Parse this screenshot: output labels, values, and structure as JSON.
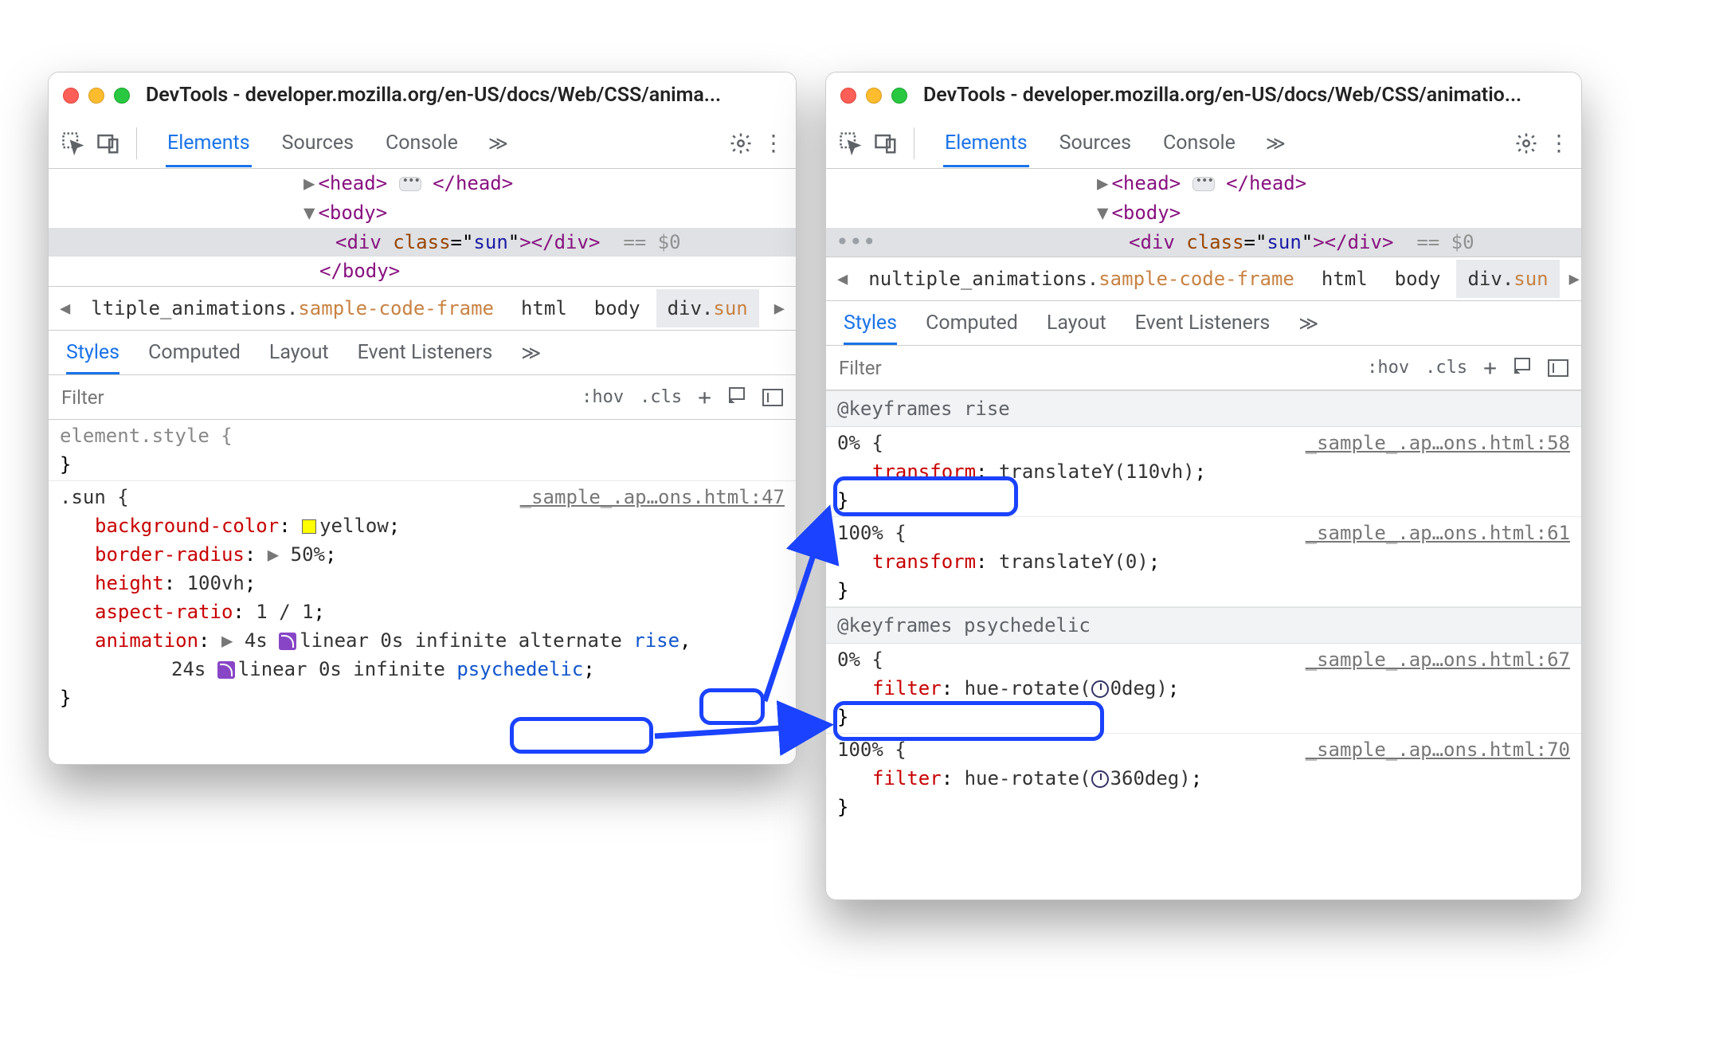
{
  "window_left": {
    "title": "DevTools - developer.mozilla.org/en-US/docs/Web/CSS/anima...",
    "tabs": [
      "Elements",
      "Sources",
      "Console"
    ],
    "dom": {
      "head_open": "<head>",
      "head_close": "</head>",
      "body_open": "<body>",
      "body_close": "</body>",
      "div_tag": "div",
      "div_attr": "class",
      "div_val": "sun",
      "eq0": "== $0"
    },
    "breadcrumb": {
      "first": "ltiple_animations.",
      "first_hl": "sample-code-frame",
      "items": [
        "html",
        "body",
        "div.sun"
      ]
    },
    "subtabs": [
      "Styles",
      "Computed",
      "Layout",
      "Event Listeners"
    ],
    "filter_placeholder": "Filter",
    "ctrls": {
      "hov": ":hov",
      "cls": ".cls"
    },
    "styles": {
      "element_style": "element.style {",
      "sun_sel": ".sun {",
      "sun_src": "_sample_.ap…ons.html:47",
      "props": {
        "bg": "background-color",
        "bgv": "yellow",
        "br": "border-radius",
        "brv": "50%",
        "h": "height",
        "hv": "100vh",
        "ar": "aspect-ratio",
        "arv": "1 / 1",
        "anim": "animation",
        "anim1a": "4s ",
        "anim1b": "linear 0s infinite alternate ",
        "anim1link": "rise",
        "anim2a": "24s ",
        "anim2b": "linear 0s infinite ",
        "anim2link": "psychedelic"
      }
    }
  },
  "window_right": {
    "title": "DevTools - developer.mozilla.org/en-US/docs/Web/CSS/animatio...",
    "tabs": [
      "Elements",
      "Sources",
      "Console"
    ],
    "dom": {
      "head_open": "<head>",
      "head_close": "</head>",
      "body_open": "<body>",
      "body_close": "</body>",
      "div_tag": "div",
      "div_attr": "class",
      "div_val": "sun",
      "eq0": "== $0"
    },
    "breadcrumb": {
      "first": "nultiple_animations.",
      "first_hl": "sample-code-frame",
      "items": [
        "html",
        "body",
        "div.sun"
      ]
    },
    "subtabs": [
      "Styles",
      "Computed",
      "Layout",
      "Event Listeners"
    ],
    "filter_placeholder": "Filter",
    "ctrls": {
      "hov": ":hov",
      "cls": ".cls"
    },
    "keyframes": {
      "rise": {
        "head": "@keyframes rise",
        "f0": {
          "pct": "0% {",
          "src": "_sample_.ap…ons.html:58",
          "prop": "transform",
          "val": "translateY(110vh)"
        },
        "f100": {
          "pct": "100% {",
          "src": "_sample_.ap…ons.html:61",
          "prop": "transform",
          "val": "translateY(0)"
        }
      },
      "psy": {
        "head": "@keyframes psychedelic",
        "f0": {
          "pct": "0% {",
          "src": "_sample_.ap…ons.html:67",
          "prop": "filter",
          "val": "hue-rotate(",
          "valdeg": "0deg)"
        },
        "f100": {
          "pct": "100% {",
          "src": "_sample_.ap…ons.html:70",
          "prop": "filter",
          "val": "hue-rotate(",
          "valdeg": "360deg)"
        }
      }
    }
  }
}
